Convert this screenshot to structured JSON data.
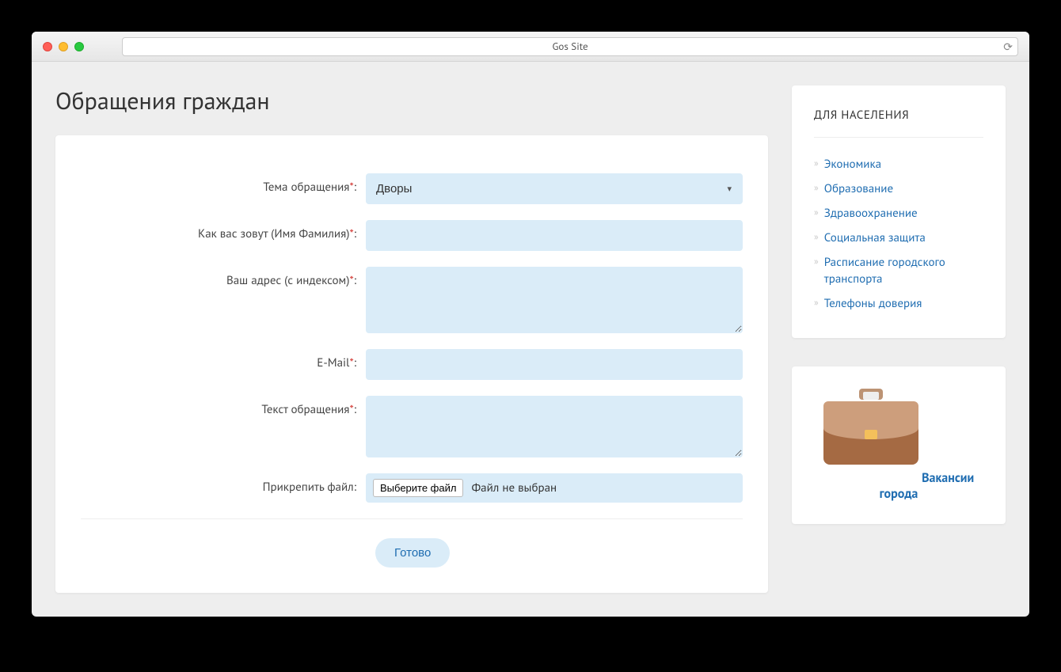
{
  "browser": {
    "title": "Gos Site"
  },
  "page": {
    "title": "Обращения граждан"
  },
  "form": {
    "fields": {
      "topic": {
        "label": "Тема обращения",
        "required": true,
        "selected": "Дворы"
      },
      "name": {
        "label": "Как вас зовут (Имя Фамилия)",
        "required": true,
        "value": ""
      },
      "address": {
        "label": "Ваш адрес (с индексом)",
        "required": true,
        "value": ""
      },
      "email": {
        "label": "E-Mail",
        "required": true,
        "value": ""
      },
      "message": {
        "label": "Текст обращения",
        "required": true,
        "value": ""
      },
      "file": {
        "label": "Прикрепить файл",
        "required": false,
        "choose_label": "Выберите файл",
        "no_file_text": "Файл не выбран"
      }
    },
    "submit_label": "Готово",
    "required_mark": "*",
    "colon": ":"
  },
  "sidebar": {
    "title": "ДЛЯ НАСЕЛЕНИЯ",
    "items": [
      "Экономика",
      "Образование",
      "Здравоохранение",
      "Социальная защита",
      "Расписание городского транспорта",
      "Телефоны доверия"
    ]
  },
  "vacancies": {
    "label": "Вакансии города"
  }
}
